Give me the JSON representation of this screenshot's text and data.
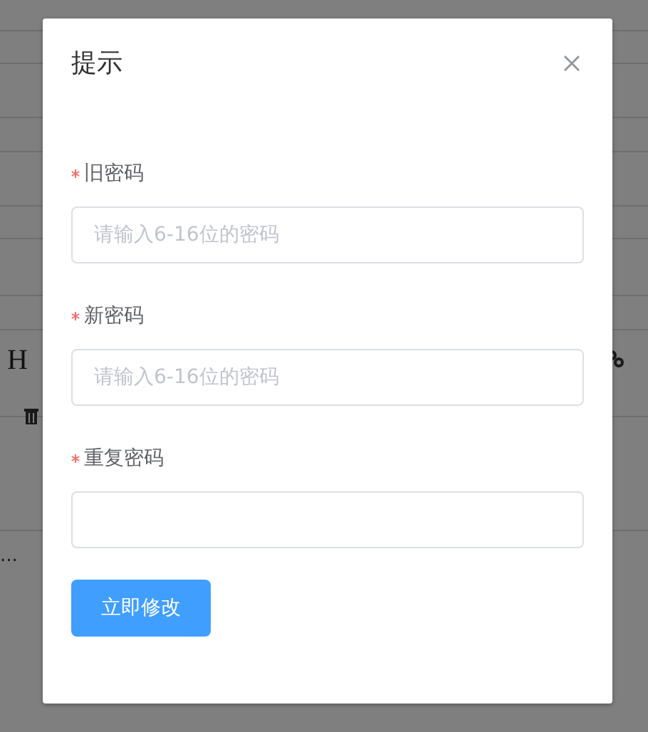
{
  "background": {
    "heading_button": "H",
    "snippet": "..."
  },
  "dialog": {
    "title": "提示",
    "fields": [
      {
        "label": "旧密码",
        "required": true,
        "placeholder": "请输入6-16位的密码"
      },
      {
        "label": "新密码",
        "required": true,
        "placeholder": "请输入6-16位的密码"
      },
      {
        "label": "重复密码",
        "required": true
      }
    ],
    "submit_button": "立即修改"
  }
}
